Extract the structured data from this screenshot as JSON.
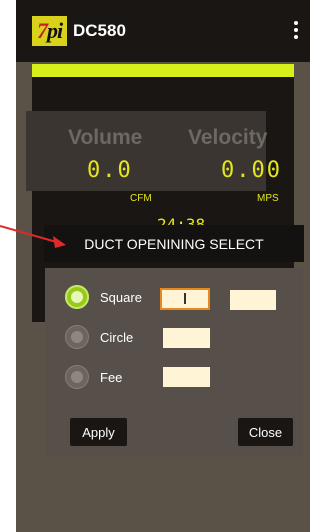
{
  "app": {
    "title": "DC580",
    "logo_text_prefix": "7",
    "logo_text_suffix": "pi",
    "brand_color": "#d9d21a",
    "accent_color": "#d8f019"
  },
  "readings": {
    "volume": {
      "label": "Volume",
      "value": "0.0",
      "unit": "CFM"
    },
    "velocity": {
      "label": "Velocity",
      "value": "0.00",
      "unit": "MPS"
    },
    "clock_partial": "24:38"
  },
  "dialog": {
    "title": "DUCT OPENINING SELECT",
    "options": [
      {
        "label": "Square",
        "selected": true
      },
      {
        "label": "Circle",
        "selected": false
      },
      {
        "label": "Fee",
        "selected": false
      }
    ],
    "buttons": {
      "apply": "Apply",
      "close": "Close"
    }
  },
  "icons": {
    "menu": "overflow-menu-icon",
    "pointer": "red-arrow-annotation"
  }
}
